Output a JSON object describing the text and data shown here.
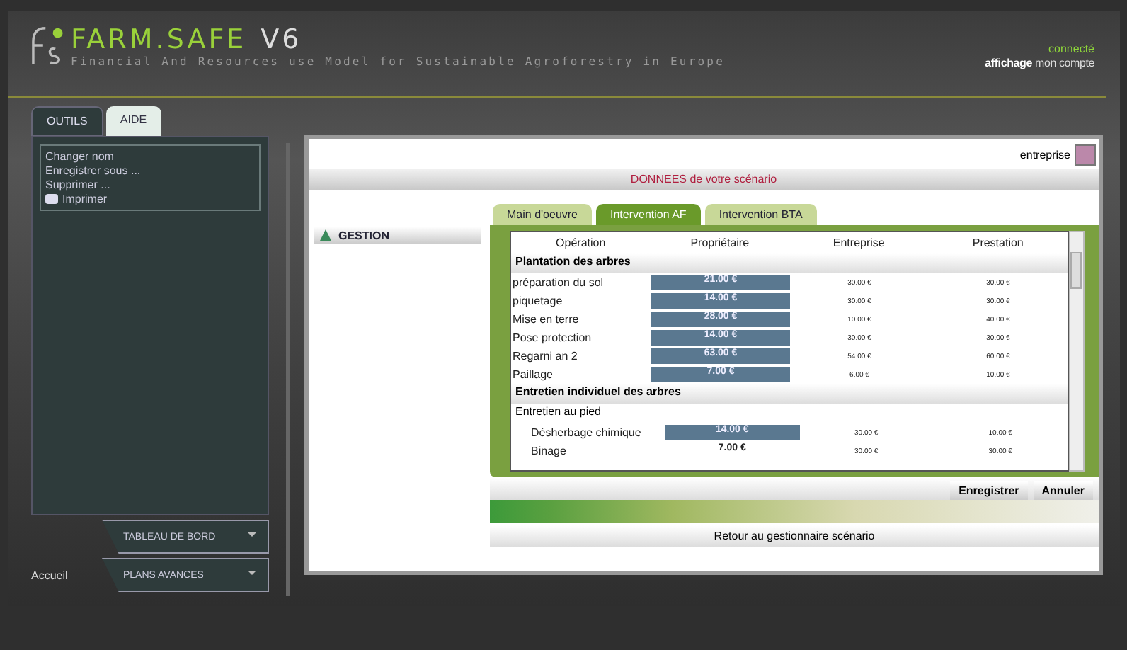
{
  "header": {
    "logo": "FARM.SAFE",
    "version": "V6",
    "subtitle": "Financial And Resources use Model for Sustainable Agroforestry in Europe",
    "status": "connecté",
    "account_link": "**affichage** mon compte"
  },
  "sidebar": {
    "tabs": [
      {
        "label": "OUTILS",
        "selected": true
      },
      {
        "label": "AIDE",
        "selected": false
      }
    ],
    "menu": [
      {
        "label": "Changer nom",
        "kind": "text"
      },
      {
        "label": "Enregistrer sous ...",
        "kind": "text"
      },
      {
        "label": "Supprimer ...",
        "kind": "text"
      },
      {
        "label": "Imprimer",
        "kind": "print"
      }
    ],
    "nav_label": "Accueil",
    "nav_buttons": [
      "TABLEAU DE BORD",
      "PLANS AVANCES"
    ]
  },
  "main": {
    "profile": "entreprise",
    "banner": "DONNEES de votre scénario",
    "gestion": "GESTION",
    "tabs": [
      {
        "label": "Main d'oeuvre",
        "selected": false
      },
      {
        "label": "Intervention AF",
        "selected": true
      },
      {
        "label": "Intervention BTA",
        "selected": false
      }
    ],
    "columns": [
      "Opération",
      "Propriétaire",
      "Entreprise",
      "Prestation"
    ],
    "rows": [
      {
        "kind": "section",
        "label": "Plantation des arbres"
      },
      {
        "kind": "row",
        "label": "préparation du sol",
        "owner": "21.00 €",
        "editable": true,
        "company": "30.00 €",
        "service": "30.00 €"
      },
      {
        "kind": "row",
        "label": "piquetage",
        "owner": "14.00 €",
        "editable": true,
        "company": "30.00 €",
        "service": "30.00 €"
      },
      {
        "kind": "row",
        "label": "Mise en terre",
        "owner": "28.00 €",
        "editable": true,
        "company": "10.00 €",
        "service": "40.00 €"
      },
      {
        "kind": "row",
        "label": "Pose protection",
        "owner": "14.00 €",
        "editable": true,
        "company": "30.00 €",
        "service": "30.00 €"
      },
      {
        "kind": "row",
        "label": "Regarni an 2",
        "owner": "63.00 €",
        "editable": true,
        "company": "54.00 €",
        "service": "60.00 €"
      },
      {
        "kind": "row",
        "label": "Paillage",
        "owner": "7.00 €",
        "editable": true,
        "company": "6.00 €",
        "service": "10.00 €"
      },
      {
        "kind": "section",
        "label": "Entretien individuel des arbres"
      },
      {
        "kind": "subsection",
        "label": "Entretien au pied"
      },
      {
        "kind": "subrow",
        "label": "Désherbage chimique",
        "owner": "14.00 €",
        "editable": true,
        "company": "30.00 €",
        "service": "10.00 €"
      },
      {
        "kind": "subrow",
        "label": "Binage",
        "owner": "7.00 €",
        "editable": false,
        "company": "30.00 €",
        "service": "30.00 €"
      }
    ],
    "actions": [
      "Enregistrer",
      "Annuler"
    ],
    "back": "Retour au gestionnaire scénario"
  }
}
